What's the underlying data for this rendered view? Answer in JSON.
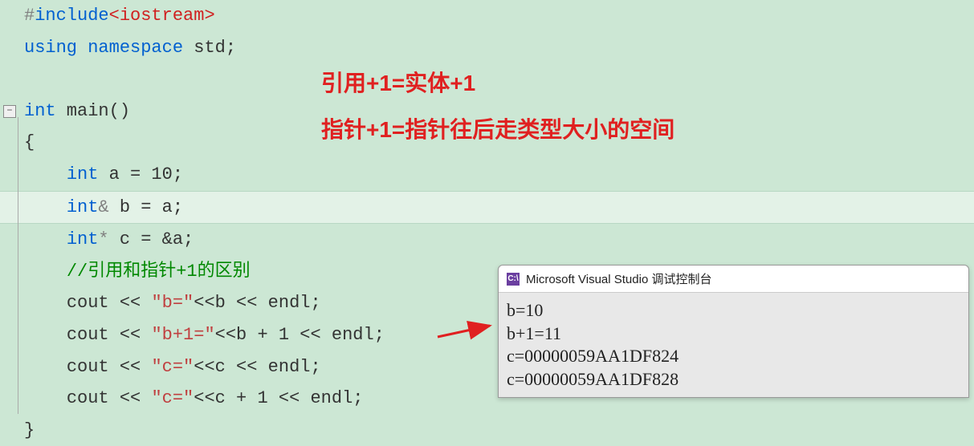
{
  "annotation": {
    "line1": "引用+1=实体+1",
    "line2": "指针+1=指针往后走类型大小的空间"
  },
  "code": {
    "include_hash": "#",
    "include_kw": "include",
    "include_angle_open": "<",
    "include_header": "iostream",
    "include_angle_close": ">",
    "using_kw": "using",
    "namespace_kw": "namespace",
    "std_ident": " std;",
    "int_kw": "int",
    "main_ident": " main()",
    "brace_open": "{",
    "decl_a_int": "int",
    "decl_a_rest": " a = 10;",
    "decl_b_int": "int",
    "decl_b_amp": "&",
    "decl_b_rest": " b = a;",
    "decl_c_int": "int",
    "decl_c_star": "*",
    "decl_c_rest": " c = &a;",
    "comment": "//引用和指针+1的区别",
    "cout1_cout": "cout << ",
    "cout1_str": "\"b=\"",
    "cout1_mid": "<<b << ",
    "cout1_endl": "endl",
    "cout1_semi": ";",
    "cout2_cout": "cout << ",
    "cout2_str": "\"b+1=\"",
    "cout2_mid": "<<b + 1 << ",
    "cout2_endl": "endl",
    "cout2_semi": ";",
    "cout3_cout": "cout << ",
    "cout3_str": "\"c=\"",
    "cout3_mid": "<<c << ",
    "cout3_endl": "endl",
    "cout3_semi": ";",
    "cout4_cout": "cout << ",
    "cout4_str": "\"c=\"",
    "cout4_mid": "<<c + 1 << ",
    "cout4_endl": "endl",
    "cout4_semi": ";",
    "brace_close": "}"
  },
  "console": {
    "title": "Microsoft Visual Studio 调试控制台",
    "icon_text": "C:\\",
    "lines": [
      "b=10",
      "b+1=11",
      "c=00000059AA1DF824",
      "c=00000059AA1DF828"
    ]
  },
  "gutter": {
    "collapse_symbol": "−"
  }
}
